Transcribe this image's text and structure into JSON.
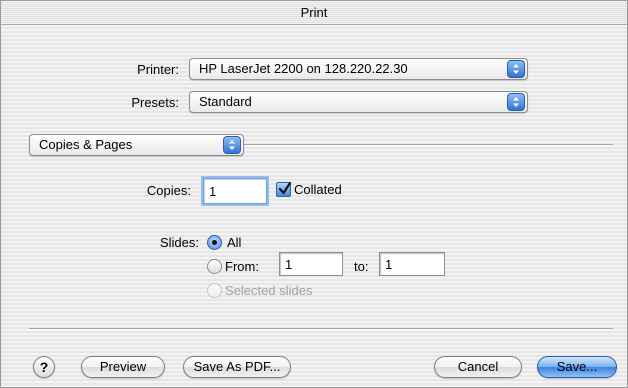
{
  "window": {
    "title": "Print"
  },
  "printer": {
    "label": "Printer:",
    "selected": "HP LaserJet 2200 on 128.220.22.30"
  },
  "presets": {
    "label": "Presets:",
    "selected": "Standard"
  },
  "panel": {
    "selected": "Copies & Pages"
  },
  "copies": {
    "label": "Copies:",
    "value": "1",
    "collated_label": "Collated",
    "collated_checked": true
  },
  "slides": {
    "label": "Slides:",
    "all_label": "All",
    "from_label": "From:",
    "from_value": "1",
    "to_label": "to:",
    "to_value": "1",
    "selected_slides_label": "Selected slides",
    "selected": "all"
  },
  "buttons": {
    "help": "?",
    "preview": "Preview",
    "save_as_pdf": "Save As PDF...",
    "cancel": "Cancel",
    "save": "Save..."
  },
  "colors": {
    "accent": "#3b82de"
  }
}
